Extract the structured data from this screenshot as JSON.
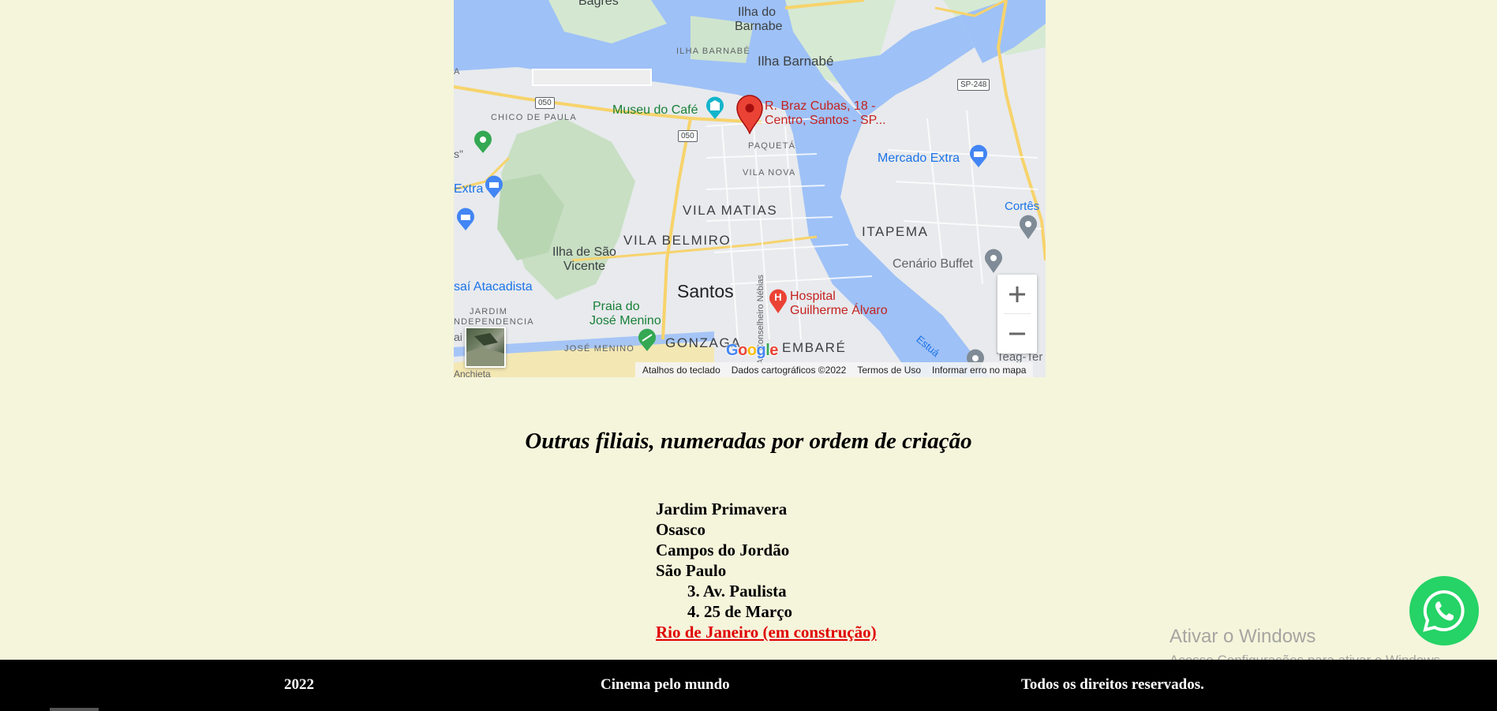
{
  "map": {
    "pin_label": "R. Braz Cubas, 18 - Centro, Santos - SP...",
    "pin_label_line1": "R. Braz Cubas, 18 -",
    "pin_label_line2": "Centro, Santos - SP...",
    "labels": {
      "bagres": "Bagres",
      "ilha_do_barnabe_1": "Ilha do",
      "ilha_do_barnabe_2": "Barnabe",
      "ilha_barnabe_caps": "ILHA BARNABÉ",
      "ilha_barnabe": "Ilha Barnabé",
      "chico_de_paula": "CHICO DE PAULA",
      "museu_do_cafe": "Museu do Café",
      "paqueta": "PAQUETÁ",
      "vila_nova": "VILA NOVA",
      "vila_matias": "VILA MATIAS",
      "vila_belmiro": "VILA BELMIRO",
      "itapema": "ITAPEMA",
      "mercado_extra": "Mercado Extra",
      "cortes": "Cortês",
      "cenario_buffet": "Cenário Buffet",
      "extra_left": "Extra",
      "ilha_sao_vicente_1": "Ilha de São",
      "ilha_sao_vicente_2": "Vicente",
      "santos": "Santos",
      "hospital_1": "Hospital",
      "hospital_2": "Guilherme Álvaro",
      "assai": "saí Atacadista",
      "jardim_1": "JARDIM",
      "jardim_2": "NDEPENDENCIA",
      "praia_1": "Praia do",
      "praia_2": "José Menino",
      "jose_menino": "JOSÉ MENINO",
      "gonzaga": "GONZAGA",
      "embare": "EMBARÉ",
      "conselheiro": "Av. Conselheiro Nébias",
      "estuario": "Estuá",
      "teag": "Teag-Ter",
      "letter_a": "A",
      "letter_s": "s\"",
      "letter_ai": "ai",
      "anchieta": "Anchieta"
    },
    "shields": {
      "r050a": "050",
      "r050b": "050",
      "sp248": "SP-248"
    },
    "zoom_in": "+",
    "zoom_out": "−",
    "google_logo": "Google",
    "attribution": {
      "shortcuts": "Atalhos do teclado",
      "data": "Dados cartográficos ©2022",
      "terms": "Termos de Uso",
      "report": "Informar erro no mapa"
    }
  },
  "branches": {
    "title": "Outras filiais, numeradas por ordem de criação",
    "items": [
      "Jardim Primavera",
      "Osasco",
      "Campos do Jordão",
      "São Paulo"
    ],
    "sub_items": [
      "3. Av. Paulista",
      "4. 25 de Março"
    ],
    "link": "Rio de Janeiro (em construção)"
  },
  "watermark": {
    "title": "Ativar o Windows",
    "subtitle": "Acesse Configurações para ativar o Windows."
  },
  "footer": {
    "year": "2022",
    "center": "Cinema pelo mundo",
    "rights": "Todos os direitos reservados."
  },
  "colors": {
    "background": "#f5f5dc",
    "water": "#9ec1f7",
    "link": "#e00000",
    "whatsapp": "#25d366",
    "footer": "#000000"
  }
}
